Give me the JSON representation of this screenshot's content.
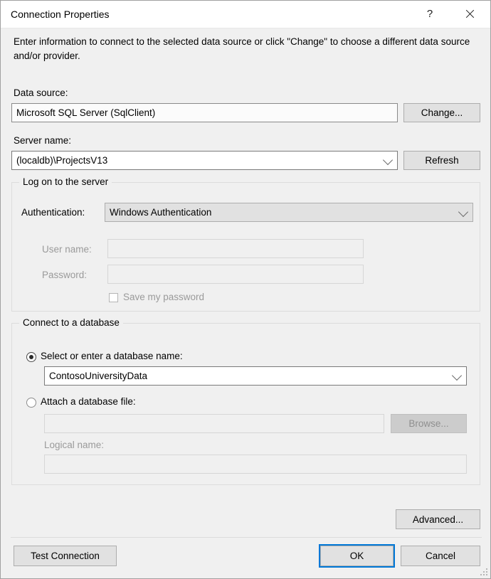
{
  "window": {
    "title": "Connection Properties",
    "help_glyph": "?",
    "close_glyph": "×"
  },
  "intro": "Enter information to connect to the selected data source or click \"Change\" to choose a different data source and/or provider.",
  "data_source": {
    "label": "Data source:",
    "value": "Microsoft SQL Server (SqlClient)",
    "change_button": "Change..."
  },
  "server": {
    "label": "Server name:",
    "value": "(localdb)\\ProjectsV13",
    "refresh_button": "Refresh"
  },
  "logon_group": {
    "title": "Log on to the server",
    "authentication_label": "Authentication:",
    "authentication_value": "Windows Authentication",
    "username_label": "User name:",
    "username_value": "",
    "password_label": "Password:",
    "password_value": "",
    "save_password_label": "Save my password",
    "save_password_checked": false
  },
  "database_group": {
    "title": "Connect to a database",
    "select_radio_label": "Select or enter a database name:",
    "select_radio_selected": true,
    "database_name_value": "ContosoUniversityData",
    "attach_radio_label": "Attach a database file:",
    "attach_radio_selected": false,
    "attach_file_value": "",
    "browse_button": "Browse...",
    "logical_name_label": "Logical name:",
    "logical_name_value": ""
  },
  "advanced_button": "Advanced...",
  "footer": {
    "test_connection": "Test Connection",
    "ok": "OK",
    "cancel": "Cancel"
  },
  "colors": {
    "accent": "#0078D7",
    "dialog_bg": "#F0F0F0",
    "button_bg": "#E1E1E1",
    "disabled_text": "#9A9A9A"
  }
}
